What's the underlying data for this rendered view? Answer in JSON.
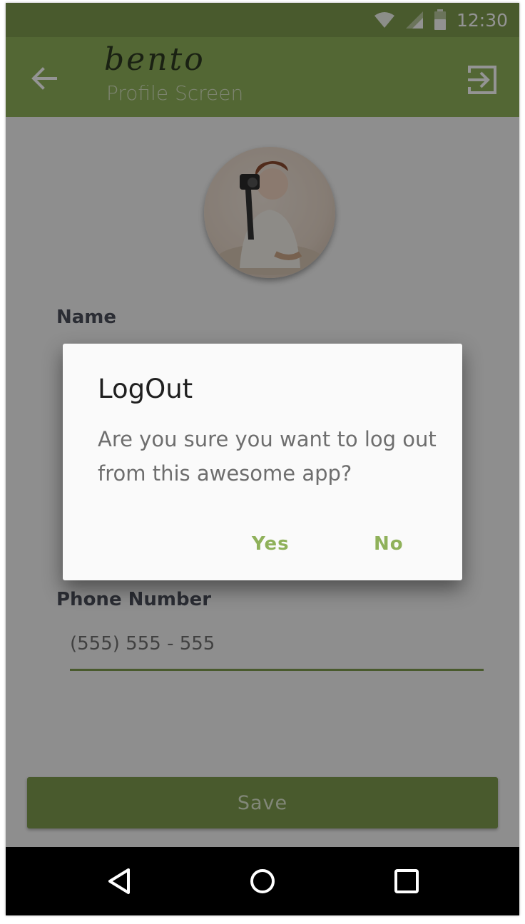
{
  "status_bar": {
    "time": "12:30",
    "icons": [
      "wifi-icon",
      "signal-icon",
      "battery-icon"
    ]
  },
  "app_bar": {
    "logo": "bento",
    "subtitle": "Profile Screen",
    "back_icon": "arrow-left-icon",
    "logout_icon": "logout-icon"
  },
  "profile": {
    "avatar": "profile-photo",
    "name_label": "Name",
    "phone_label": "Phone Number",
    "phone_value": "(555) 555 - 555",
    "save_label": "Save"
  },
  "dialog": {
    "title": "LogOut",
    "message": "Are you sure you want to log out from this awesome app?",
    "yes_label": "Yes",
    "no_label": "No"
  },
  "colors": {
    "accent": "#8fb15a",
    "accent_dark": "#7f9c4e",
    "scrim": "rgba(0,0,0,0.42)"
  },
  "nav_bar": {
    "icons": [
      "back-nav-icon",
      "home-nav-icon",
      "recents-nav-icon"
    ]
  }
}
